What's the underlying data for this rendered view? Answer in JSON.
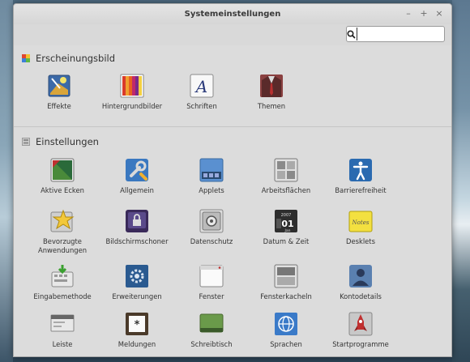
{
  "window": {
    "title": "Systemeinstellungen"
  },
  "controls": {
    "minimize": "–",
    "maximize": "+",
    "close": "×"
  },
  "search": {
    "value": "",
    "placeholder": ""
  },
  "sections": [
    {
      "title": "Erscheinungsbild",
      "items": [
        {
          "label": "Effekte",
          "icon": "effects-icon"
        },
        {
          "label": "Hintergrundbilder",
          "icon": "backgrounds-icon"
        },
        {
          "label": "Schriften",
          "icon": "fonts-icon"
        },
        {
          "label": "Themen",
          "icon": "themes-icon"
        }
      ]
    },
    {
      "title": "Einstellungen",
      "items": [
        {
          "label": "Aktive Ecken",
          "icon": "hot-corners-icon"
        },
        {
          "label": "Allgemein",
          "icon": "general-icon"
        },
        {
          "label": "Applets",
          "icon": "applets-icon"
        },
        {
          "label": "Arbeitsflächen",
          "icon": "workspaces-icon"
        },
        {
          "label": "Barrierefreiheit",
          "icon": "accessibility-icon"
        },
        {
          "label": "Bevorzugte\nAnwendungen",
          "icon": "preferred-apps-icon"
        },
        {
          "label": "Bildschirmschoner",
          "icon": "screensaver-icon"
        },
        {
          "label": "Datenschutz",
          "icon": "privacy-icon"
        },
        {
          "label": "Datum & Zeit",
          "icon": "date-time-icon"
        },
        {
          "label": "Desklets",
          "icon": "desklets-icon"
        },
        {
          "label": "Eingabemethode",
          "icon": "input-method-icon"
        },
        {
          "label": "Erweiterungen",
          "icon": "extensions-icon"
        },
        {
          "label": "Fenster",
          "icon": "windows-icon"
        },
        {
          "label": "Fensterkacheln",
          "icon": "window-tiling-icon"
        },
        {
          "label": "Kontodetails",
          "icon": "account-details-icon"
        },
        {
          "label": "Leiste",
          "icon": "panel-icon"
        },
        {
          "label": "Meldungen",
          "icon": "notifications-icon"
        },
        {
          "label": "Schreibtisch",
          "icon": "desktop-icon"
        },
        {
          "label": "Sprachen",
          "icon": "languages-icon"
        },
        {
          "label": "Startprogramme",
          "icon": "startup-apps-icon"
        }
      ]
    }
  ],
  "datetime_icon": {
    "year": "2007",
    "day": "01",
    "month": "Jan"
  },
  "desklets_icon": {
    "text": "Notes"
  }
}
